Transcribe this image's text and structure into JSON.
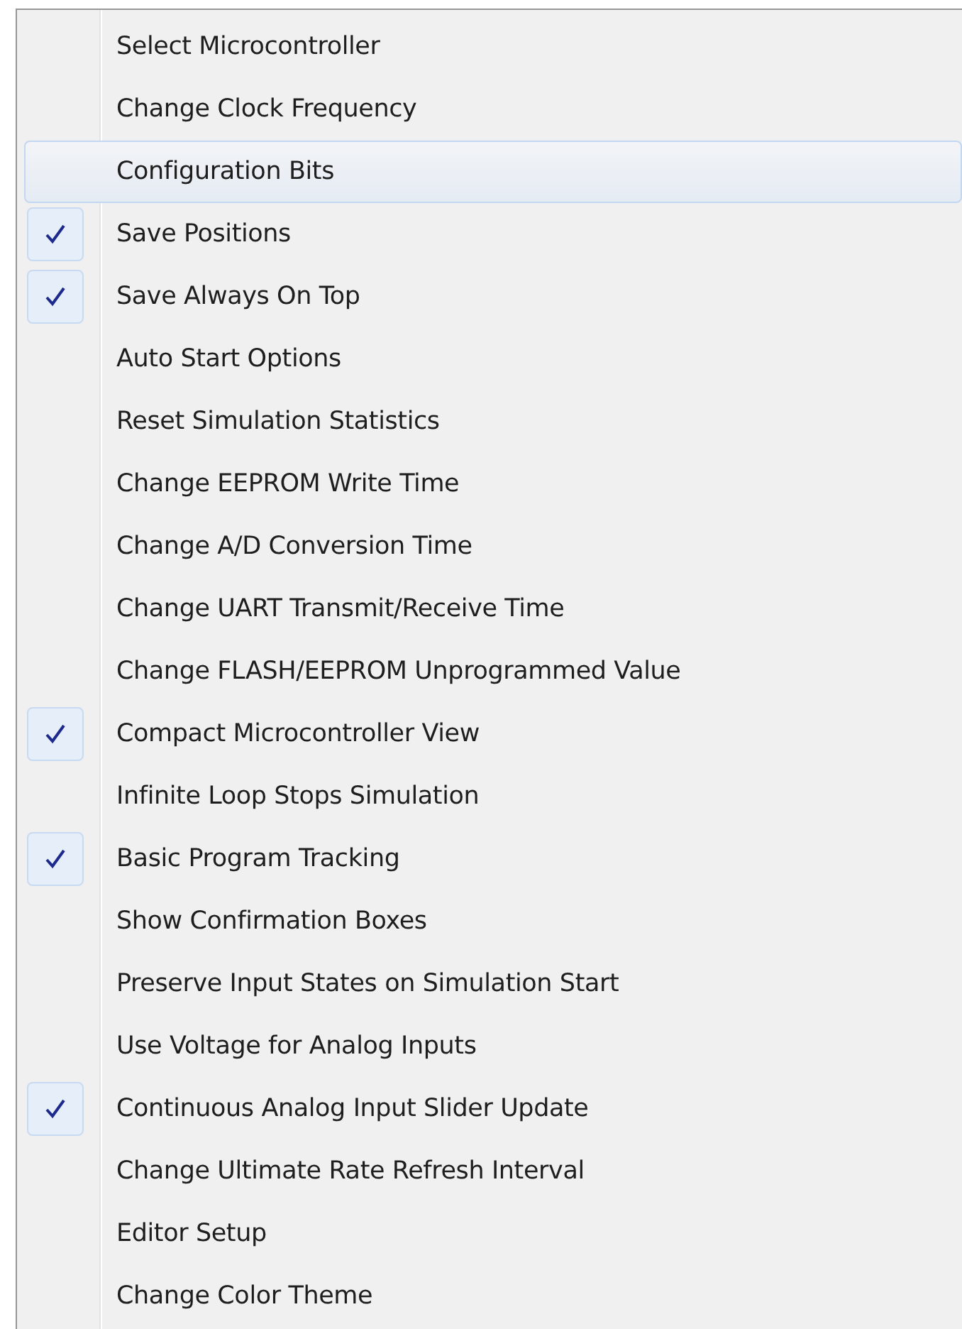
{
  "menu": {
    "items": [
      {
        "label": "Select Microcontroller",
        "checked": false,
        "selected": false
      },
      {
        "label": "Change Clock Frequency",
        "checked": false,
        "selected": false
      },
      {
        "label": "Configuration Bits",
        "checked": false,
        "selected": true
      },
      {
        "label": "Save Positions",
        "checked": true,
        "selected": false
      },
      {
        "label": "Save Always On Top",
        "checked": true,
        "selected": false
      },
      {
        "label": "Auto Start Options",
        "checked": false,
        "selected": false
      },
      {
        "label": "Reset Simulation Statistics",
        "checked": false,
        "selected": false
      },
      {
        "label": "Change EEPROM Write Time",
        "checked": false,
        "selected": false
      },
      {
        "label": "Change A/D Conversion Time",
        "checked": false,
        "selected": false
      },
      {
        "label": "Change UART Transmit/Receive Time",
        "checked": false,
        "selected": false
      },
      {
        "label": "Change FLASH/EEPROM Unprogrammed Value",
        "checked": false,
        "selected": false
      },
      {
        "label": "Compact Microcontroller View",
        "checked": true,
        "selected": false
      },
      {
        "label": "Infinite Loop Stops Simulation",
        "checked": false,
        "selected": false
      },
      {
        "label": "Basic Program Tracking",
        "checked": true,
        "selected": false
      },
      {
        "label": "Show Confirmation Boxes",
        "checked": false,
        "selected": false
      },
      {
        "label": "Preserve Input States on Simulation Start",
        "checked": false,
        "selected": false
      },
      {
        "label": "Use Voltage for Analog Inputs",
        "checked": false,
        "selected": false
      },
      {
        "label": "Continuous Analog Input Slider Update",
        "checked": true,
        "selected": false
      },
      {
        "label": "Change Ultimate Rate Refresh Interval",
        "checked": false,
        "selected": false
      },
      {
        "label": "Editor Setup",
        "checked": false,
        "selected": false
      },
      {
        "label": "Change Color Theme",
        "checked": false,
        "selected": false
      }
    ]
  }
}
